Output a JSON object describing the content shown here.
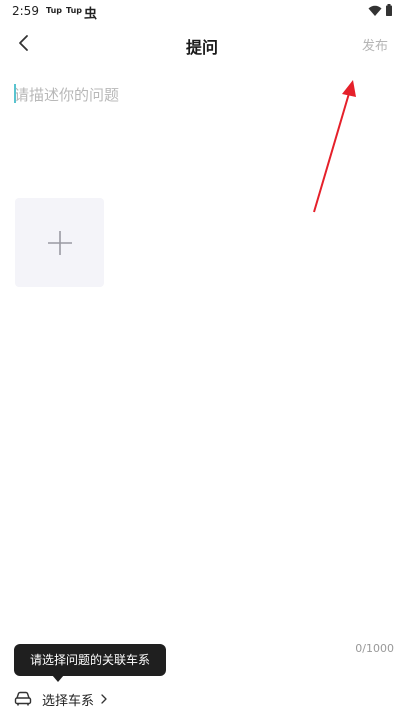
{
  "status_bar": {
    "time": "2:59",
    "notif_1": "Tup",
    "notif_2": "Tup",
    "notif_3": "虫"
  },
  "header": {
    "back_icon": "chevron-left-icon",
    "title": "提问",
    "publish_label": "发布"
  },
  "editor": {
    "placeholder": "请描述你的问题",
    "value": "",
    "char_count": "0/1000"
  },
  "add_image": {
    "icon": "plus-icon"
  },
  "tooltip": {
    "text": "请选择问题的关联车系"
  },
  "bottom_bar": {
    "car_icon": "car-icon",
    "select_series_label": "选择车系",
    "chevron_icon": "chevron-right-icon"
  },
  "colors": {
    "annotation_arrow": "#e5202a",
    "caret": "#58c3cf",
    "publish_disabled": "#b5b5b5",
    "tooltip_bg": "#1f1f1f",
    "add_image_bg": "#f4f4f9"
  }
}
